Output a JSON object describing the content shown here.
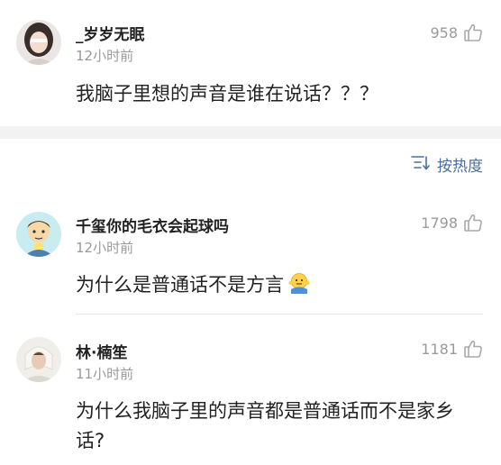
{
  "comments": [
    {
      "username": "_岁岁无眠",
      "time": "12小时前",
      "likes": "958",
      "text": "我脑子里想的声音是谁在说话？？？"
    },
    {
      "username": "千玺你的毛衣会起球吗",
      "time": "12小时前",
      "likes": "1798",
      "text": "为什么是普通话不是方言",
      "emoji": "shrug-emoji"
    },
    {
      "username": "林·楠笙",
      "time": "11小时前",
      "likes": "1181",
      "text": "为什么我脑子里的声音都是普通话而不是家乡话?"
    }
  ],
  "sort": {
    "label": "按热度",
    "icon": "sort-icon"
  },
  "colors": {
    "link_blue": "#4c6e9a",
    "meta_gray": "#9a9a9a",
    "band_gray": "#f2f2f2"
  }
}
